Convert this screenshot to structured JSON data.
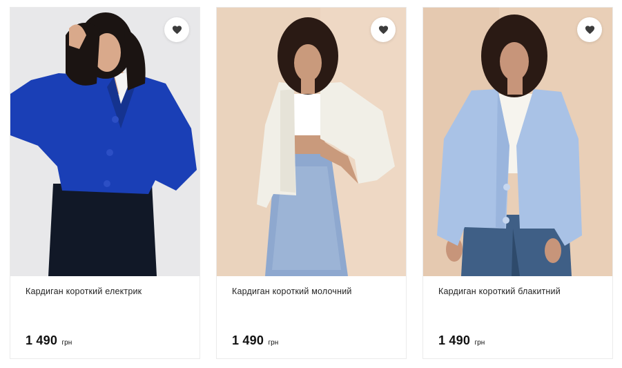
{
  "products": [
    {
      "name": "Кардиган короткий електрик",
      "price": "1 490",
      "currency": "грн",
      "favorite_icon": "heart-icon",
      "colors": {
        "background": "#ececed",
        "garment": "#1a3fb6",
        "skirt": "#111827"
      }
    },
    {
      "name": "Кардиган короткий молочний",
      "price": "1 490",
      "currency": "грн",
      "favorite_icon": "heart-icon",
      "colors": {
        "background": "#ead3bd",
        "garment": "#f1efe7",
        "skirt": "#8ea8cf"
      }
    },
    {
      "name": "Кардиган короткий блакитний",
      "price": "1 490",
      "currency": "грн",
      "favorite_icon": "heart-icon",
      "colors": {
        "background": "#e9cfb7",
        "garment": "#a9c2e6",
        "skirt": "#3f5f86"
      }
    }
  ]
}
